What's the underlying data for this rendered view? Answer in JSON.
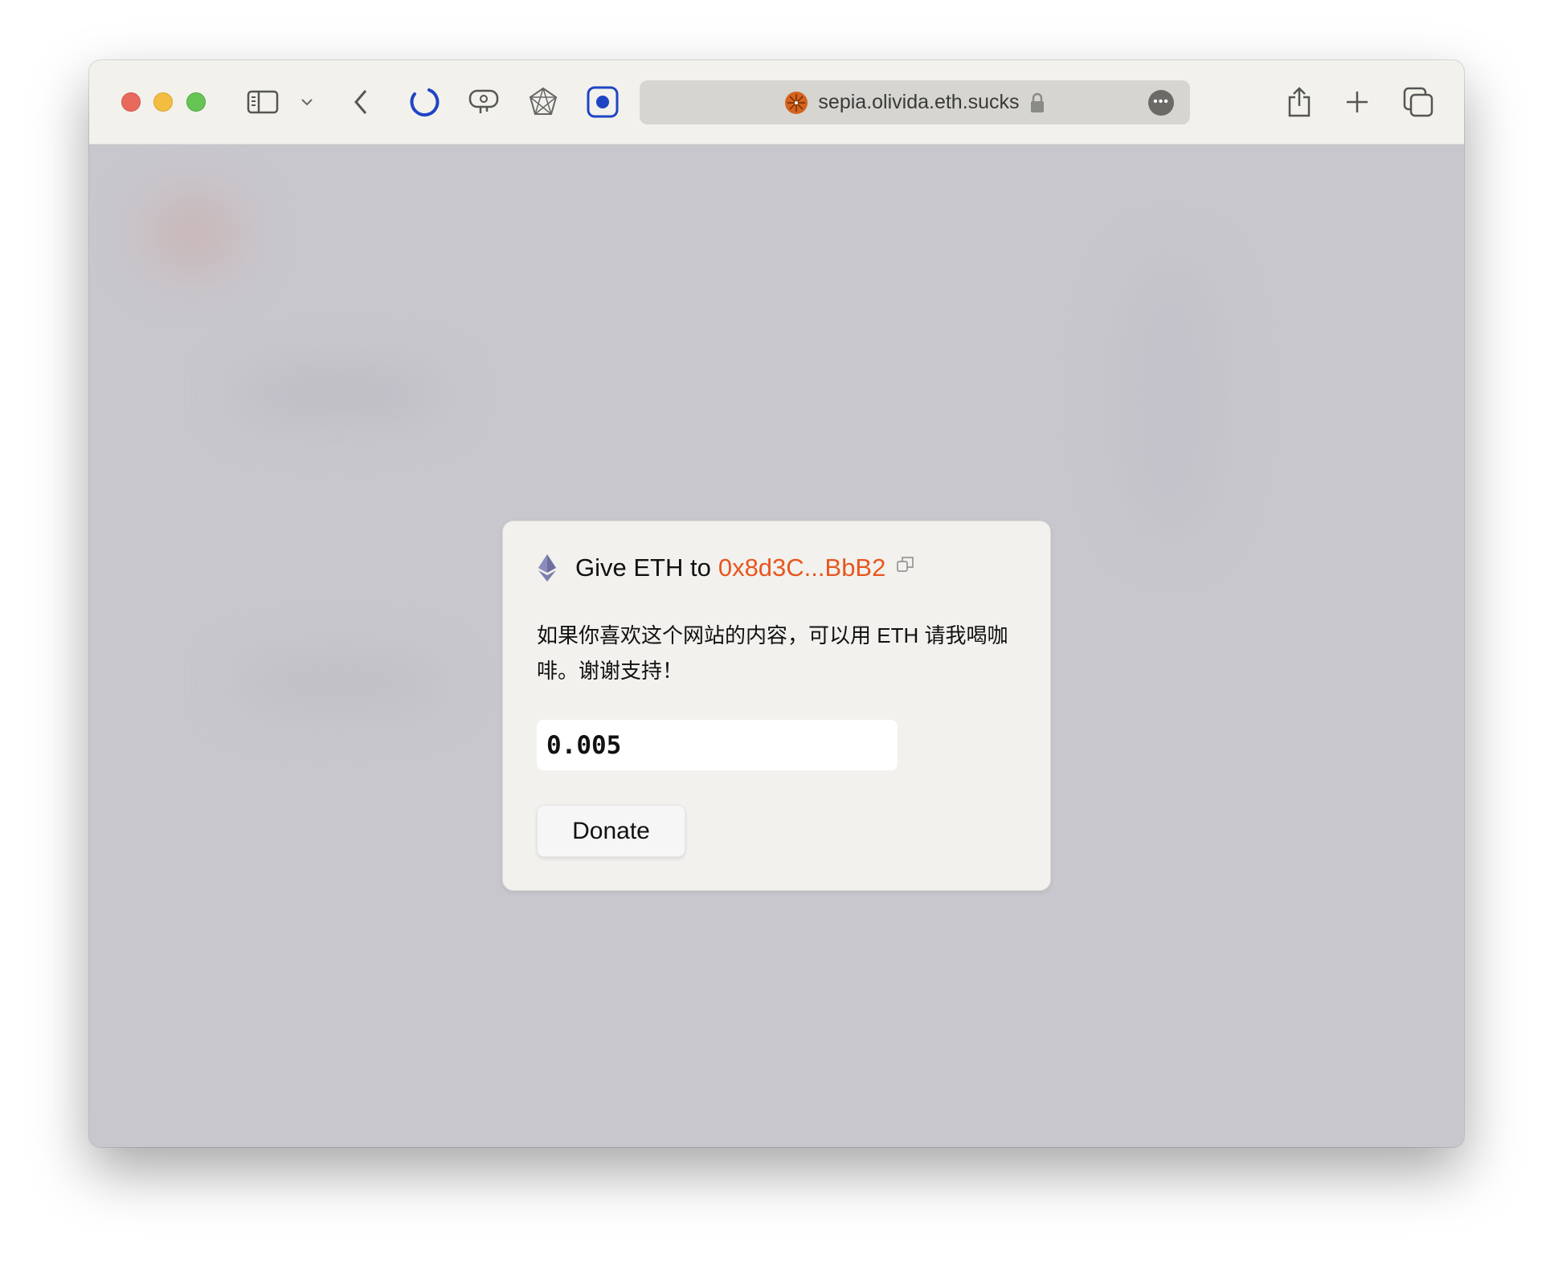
{
  "browser": {
    "url": "sepia.olivida.eth.sucks",
    "accent_color": "#1f45c4",
    "icons": [
      "close",
      "minimize",
      "zoom",
      "sidebar-icon",
      "chevron-down-icon",
      "back-icon",
      "loading-spinner-icon",
      "extension-icon",
      "network-icon",
      "record-icon",
      "favicon",
      "lock-icon",
      "more-icon",
      "share-icon",
      "new-tab-icon",
      "tabs-overview-icon"
    ]
  },
  "dialog": {
    "title_prefix": "Give ETH to",
    "address": "0x8d3C...BbB2",
    "address_color": "#e8561f",
    "description": "如果你喜欢这个网站的内容，可以用 ETH 请我喝咖啡。谢谢支持！",
    "amount_value": "0.005",
    "donate_label": "Donate"
  }
}
